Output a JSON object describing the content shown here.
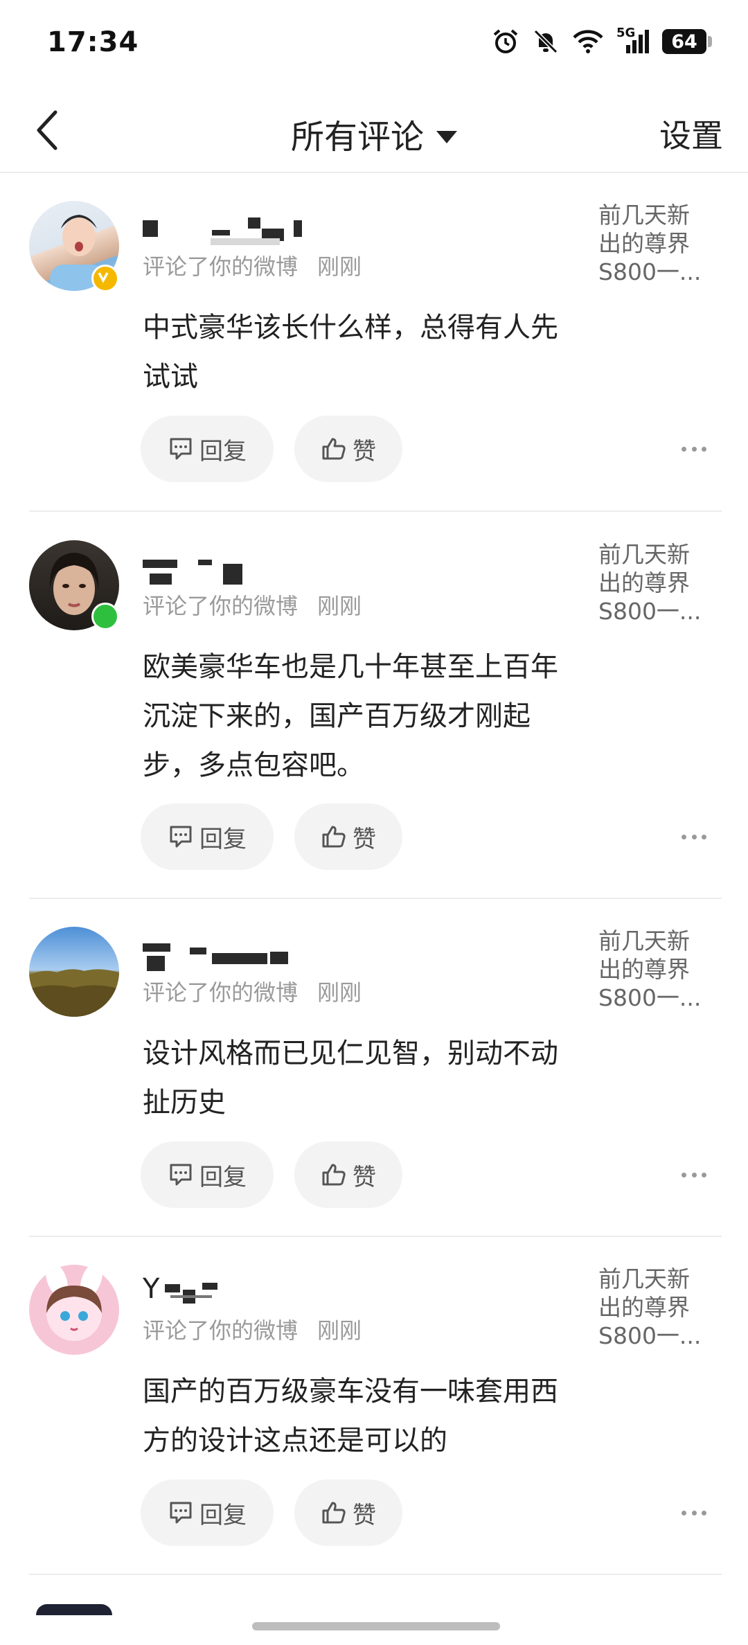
{
  "status_bar": {
    "time": "17:34",
    "battery": "64",
    "network": "5G",
    "icons": [
      "alarm-icon",
      "bell-muted-icon",
      "wifi-icon",
      "signal-icon",
      "battery-icon"
    ]
  },
  "nav": {
    "back_icon": "chevron-left-icon",
    "title": "所有评论",
    "settings": "设置"
  },
  "actions": {
    "reply": "回复",
    "like": "赞"
  },
  "comments": [
    {
      "username_visible": "",
      "meta": "评论了你的微博",
      "time": "刚刚",
      "post_ref": "前几天新出的尊界S800一...",
      "text": "中式豪华该长什么样，总得有人先试试",
      "badge": "verified-badge-icon",
      "badge_color": "#f5b800"
    },
    {
      "username_visible": "",
      "meta": "评论了你的微博",
      "time": "刚刚",
      "post_ref": "前几天新出的尊界S800一...",
      "text": "欧美豪华车也是几十年甚至上百年沉淀下来的，国产百万级才刚起步，多点包容吧。",
      "badge": "online-status-icon",
      "badge_color": "#2fbf3f"
    },
    {
      "username_visible": "",
      "meta": "评论了你的微博",
      "time": "刚刚",
      "post_ref": "前几天新出的尊界S800一...",
      "text": "设计风格而已见仁见智，别动不动扯历史"
    },
    {
      "username_visible": "Y",
      "meta": "评论了你的微博",
      "time": "刚刚",
      "post_ref": "前几天新出的尊界S800一...",
      "text": "国产的百万级豪车没有一味套用西方的设计这点还是可以的"
    }
  ]
}
